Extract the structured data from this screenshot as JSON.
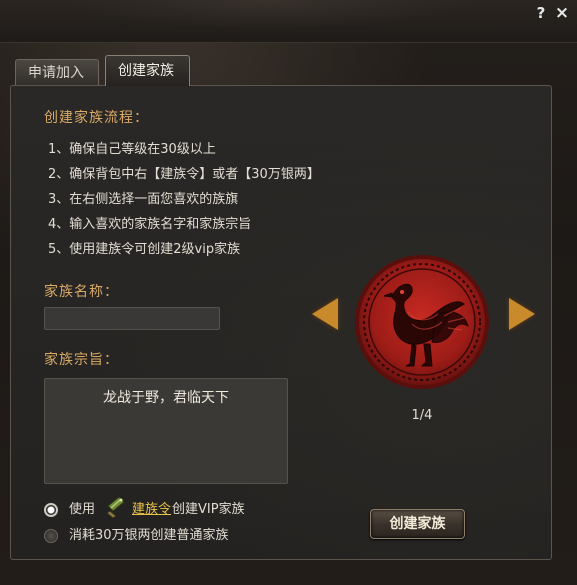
{
  "window": {
    "help_label": "?",
    "close_label": "×"
  },
  "tabs": [
    {
      "label": "申请加入",
      "active": false
    },
    {
      "label": "创建家族",
      "active": true
    }
  ],
  "process": {
    "title": "创建家族流程：",
    "steps": [
      "1、确保自己等级在30级以上",
      "2、确保背包中右【建族令】或者【30万银两】",
      "3、在右侧选择一面您喜欢的族旗",
      "4、输入喜欢的家族名字和家族宗旨",
      "5、使用建族令可创建2级vip家族"
    ]
  },
  "family_name": {
    "label": "家族名称：",
    "value": ""
  },
  "family_motto": {
    "label": "家族宗旨：",
    "value": "龙战于野，君临天下"
  },
  "emblem": {
    "icon": "phoenix-emblem-icon",
    "page": "1/4",
    "color": "#b3221d"
  },
  "options": {
    "use_label": "使用",
    "token_link": "建族令",
    "vip_label": "创建VIP家族",
    "normal_label": "消耗30万银两创建普通家族",
    "selected": "vip"
  },
  "create_button": "创建家族",
  "colors": {
    "section_title": "#d9aa66",
    "arrow": "#c98a2c",
    "link": "#e9c24a"
  }
}
